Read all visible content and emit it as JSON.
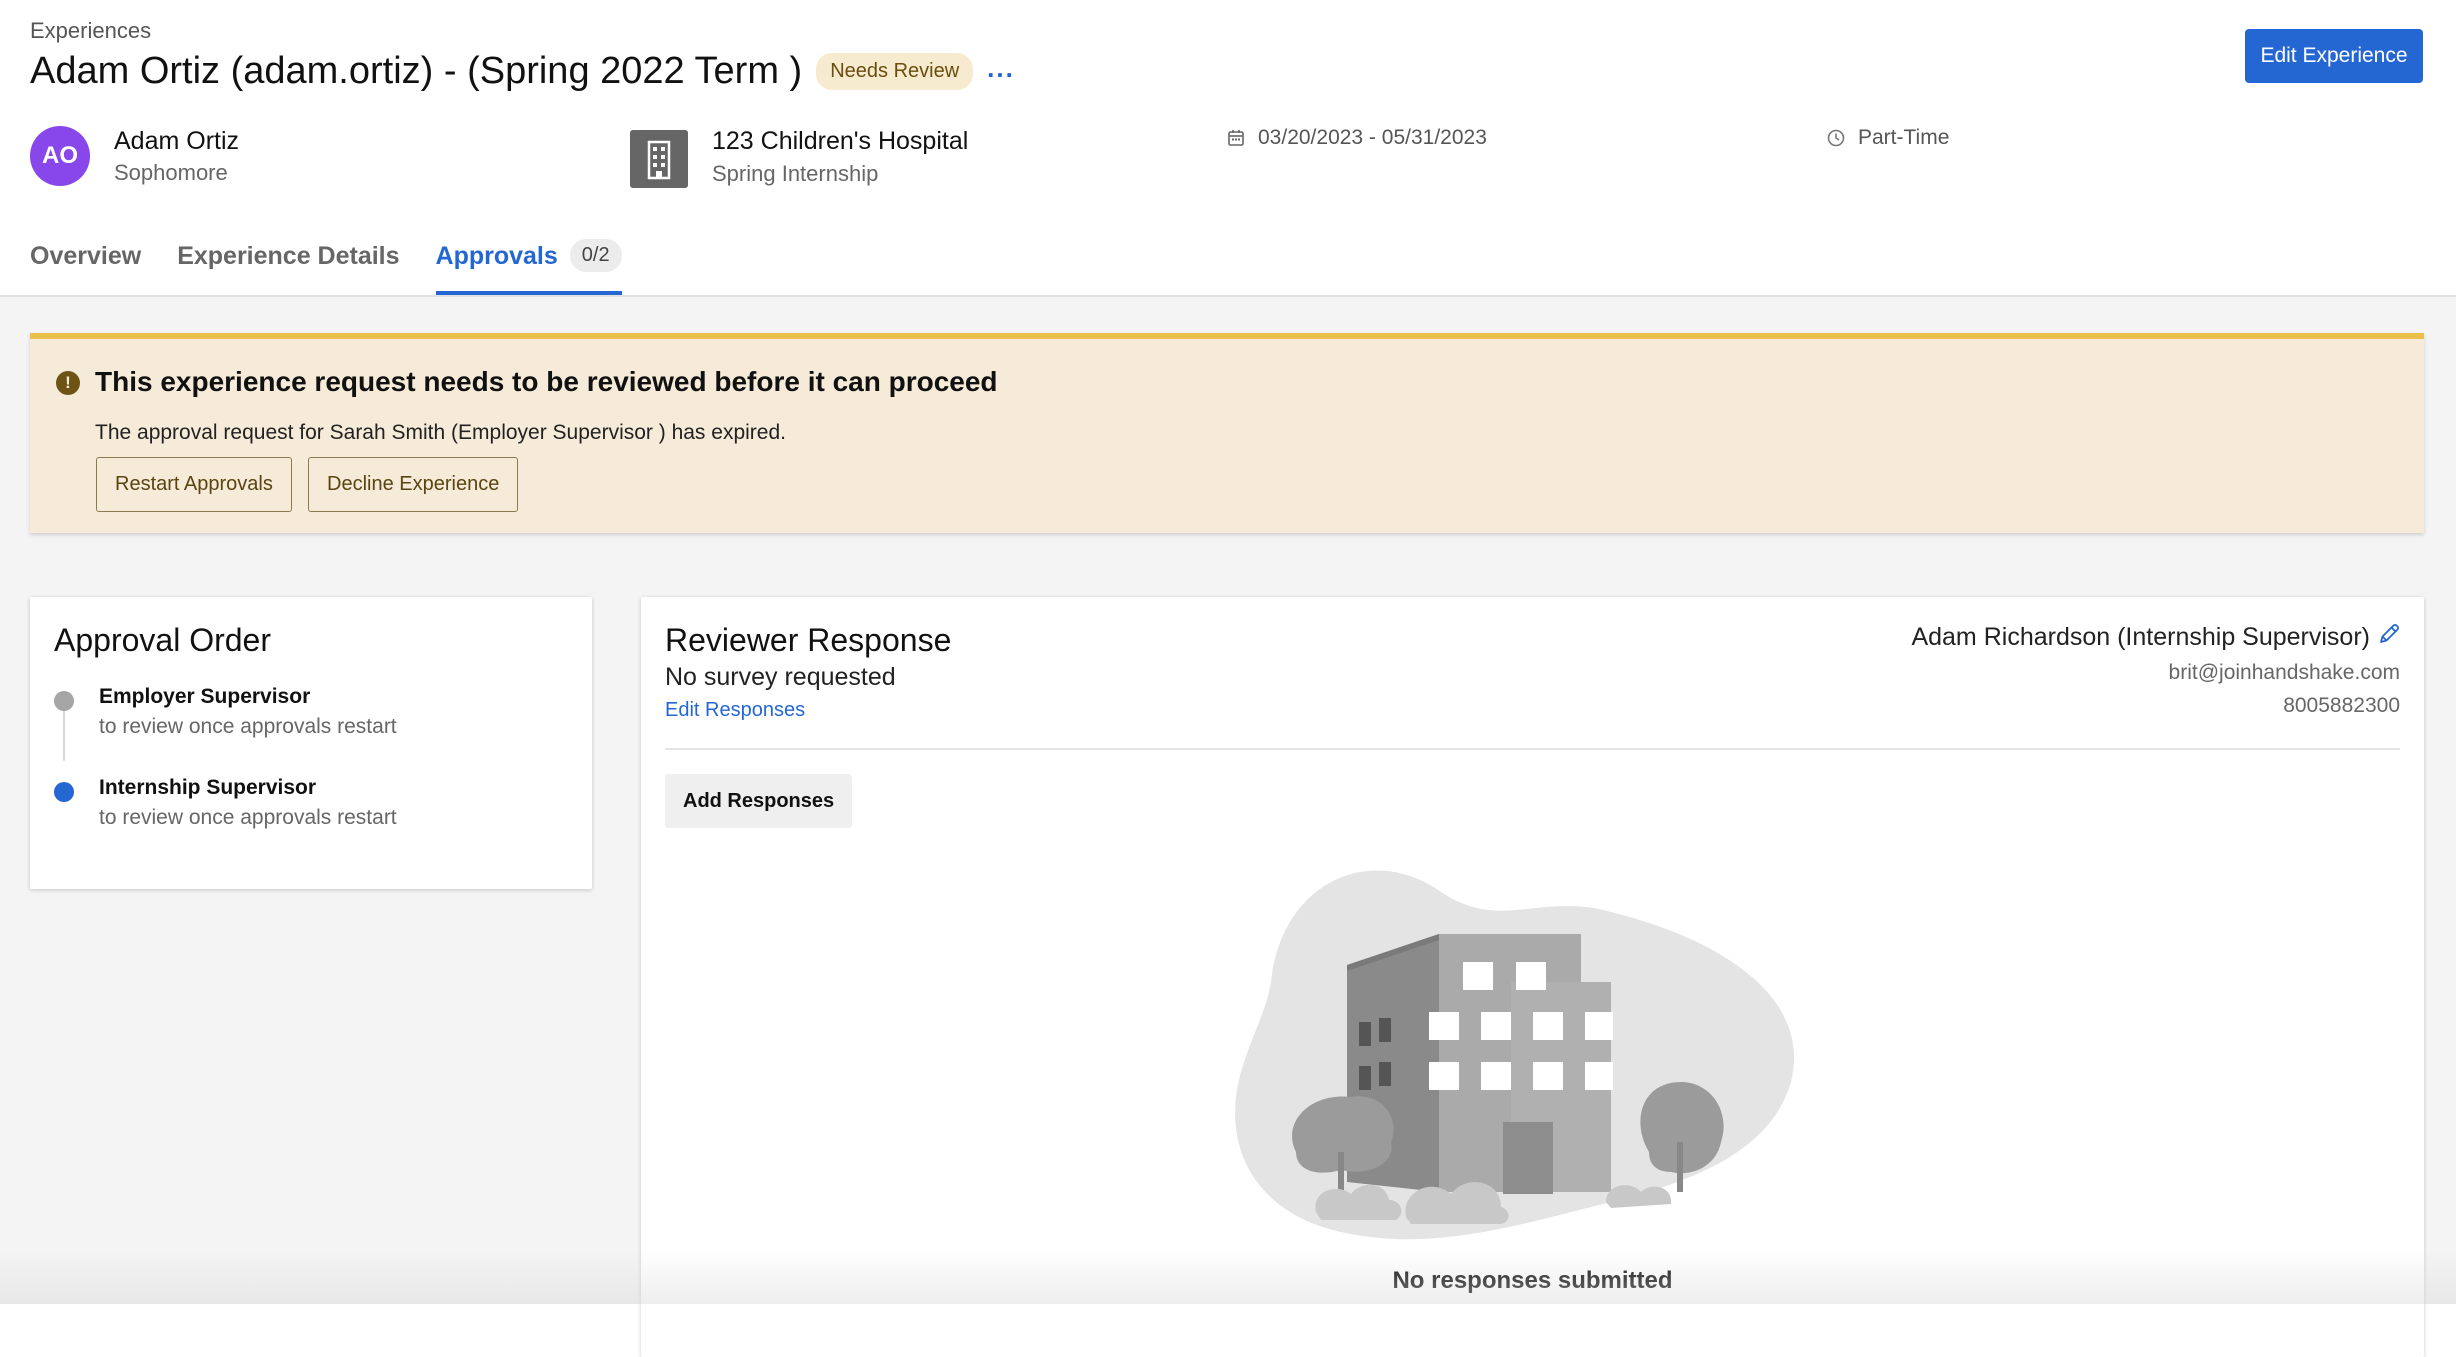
{
  "header": {
    "breadcrumb": "Experiences",
    "title": "Adam Ortiz (adam.ortiz) - (Spring 2022 Term )",
    "status_badge": "Needs Review",
    "more_label": "...",
    "edit_button": "Edit Experience"
  },
  "student": {
    "initials": "AO",
    "name": "Adam Ortiz",
    "year": "Sophomore"
  },
  "employer": {
    "icon": "building-icon",
    "name": "123 Children's Hospital",
    "position": "Spring Internship"
  },
  "dates": {
    "icon": "calendar-icon",
    "range": "03/20/2023 - 05/31/2023"
  },
  "work_type": {
    "icon": "clock-icon",
    "label": "Part-Time"
  },
  "tabs": [
    {
      "label": "Overview"
    },
    {
      "label": "Experience Details"
    },
    {
      "label": "Approvals",
      "count": "0/2",
      "active": true
    }
  ],
  "alert": {
    "icon": "exclamation-icon",
    "title": "This experience request needs to be reviewed before it can proceed",
    "message": "The approval request for Sarah Smith (Employer Supervisor ) has expired.",
    "restart_button": "Restart Approvals",
    "decline_button": "Decline Experience"
  },
  "approval_order": {
    "title": "Approval Order",
    "steps": [
      {
        "title": "Employer Supervisor",
        "status": "to review once approvals restart",
        "dot_color": "#a6a6a6"
      },
      {
        "title": "Internship Supervisor",
        "status": "to review once approvals restart",
        "dot_color": "#2467d3"
      }
    ]
  },
  "reviewer_response": {
    "title": "Reviewer Response",
    "survey_status": "No survey requested",
    "edit_link": "Edit Responses",
    "reviewer_name": "Adam Richardson (Internship Supervisor)",
    "reviewer_email": "brit@joinhandshake.com",
    "reviewer_phone": "8005882300",
    "edit_icon": "pencil-icon",
    "add_button": "Add Responses",
    "illustration": "building-illustration",
    "empty_message": "No responses submitted"
  },
  "colors": {
    "accent": "#2467d3",
    "avatar": "#8847ea",
    "alert_bg": "#f5ebd8",
    "alert_border": "#ebc04a",
    "badge_bg": "#f7ebcf"
  }
}
